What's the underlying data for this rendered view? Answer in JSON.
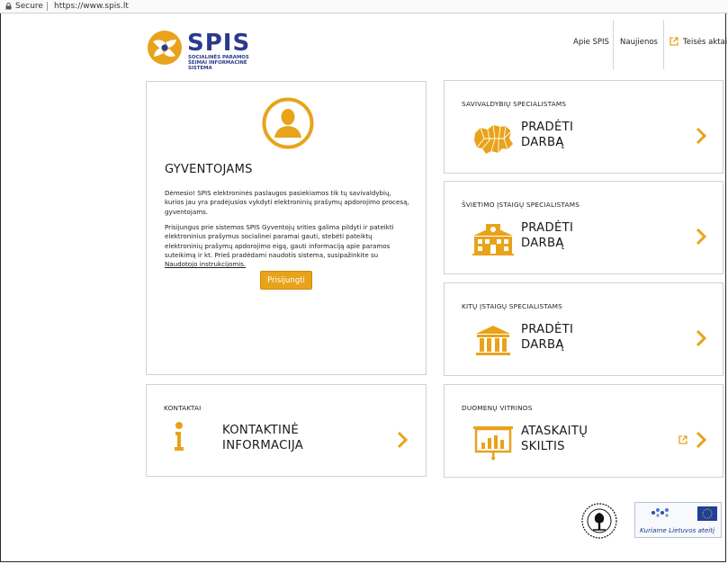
{
  "browser": {
    "secure_label": "Secure",
    "url": "https://www.spis.lt"
  },
  "header": {
    "logo_text": "SPIS",
    "logo_subtitle": "SOCIALINĖS PARAMOS ŠEIMAI INFORMACINĖ SISTEMA",
    "nav": {
      "about": "Apie SPIS",
      "news": "Naujienos",
      "legal": "Teisės aktai"
    }
  },
  "residents": {
    "title": "GYVENTOJAMS",
    "paragraph1": "Dėmesio! SPIS elektroninės paslaugos pasiekiamos tik tų savivaldybių, kurios jau yra pradėjusios vykdyti elektroninių prašymų apdorojimo procesą, gyventojams.",
    "paragraph2": "Prisijungus prie sistemos SPIS Gyventojų srities galima pildyti ir pateikti elektroninius prašymus socialinei paramai gauti, stebėti pateiktų elektroninių prašymų apdorojimo eigą, gauti informaciją apie paramos suteikimą ir kt. Prieš pradėdami naudotis sistema, susipažinkite su ",
    "paragraph2_link": "Naudotojo instrukcijomis.",
    "login_button": "Prisijungti"
  },
  "panels": {
    "municipal": {
      "caption": "SAVIVALDYBIŲ SPECIALISTAMS",
      "line1": "PRADĖTI",
      "line2": "DARBĄ"
    },
    "education": {
      "caption": "ŠVIETIMO ĮSTAIGŲ SPECIALISTAMS",
      "line1": "PRADĖTI",
      "line2": "DARBĄ"
    },
    "other": {
      "caption": "KITŲ ĮSTAIGŲ SPECIALISTAMS",
      "line1": "PRADĖTI",
      "line2": "DARBĄ"
    },
    "data": {
      "caption": "DUOMENŲ VITRINOS",
      "line1": "ATASKAITŲ",
      "line2": "SKILTIS"
    },
    "contacts": {
      "caption": "KONTAKTAI",
      "line1": "KONTAKTINĖ",
      "line2": "INFORMACIJA"
    }
  },
  "footer": {
    "eu_slogan": "Kuriame Lietuvos ateitį"
  },
  "colors": {
    "accent": "#e8a31b",
    "brand": "#2a3a8c"
  }
}
